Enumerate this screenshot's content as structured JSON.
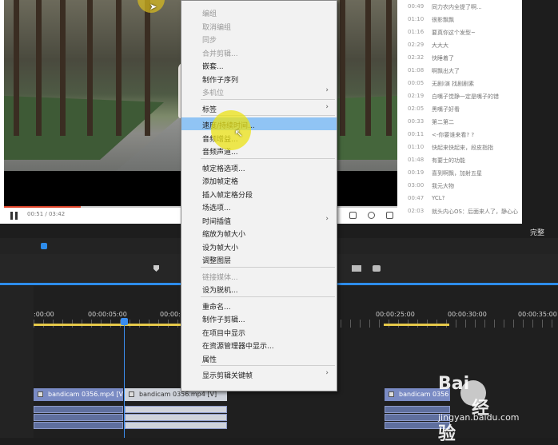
{
  "player": {
    "time": "00:51 / 03:42",
    "progress": 0.23
  },
  "comments": [
    {
      "t": "00:49",
      "m": "同力农内全提了啊..."
    },
    {
      "t": "01:10",
      "m": "很影飘飘"
    },
    {
      "t": "01:16",
      "m": "要真你这个发型~"
    },
    {
      "t": "02:29",
      "m": "大大大"
    },
    {
      "t": "02:32",
      "m": "快睡着了"
    },
    {
      "t": "01:08",
      "m": "啊飘出大了"
    },
    {
      "t": "00:05",
      "m": "无剧i演  找剧剧素"
    },
    {
      "t": "02:19",
      "m": "白嘴子觉静一定是嘴子的错"
    },
    {
      "t": "02:05",
      "m": "黑嘴子好看"
    },
    {
      "t": "00:33",
      "m": "第二第二"
    },
    {
      "t": "00:11",
      "m": "<-你要谁来看? ?"
    },
    {
      "t": "01:10",
      "m": "快起来快起来，段皮指指"
    },
    {
      "t": "01:48",
      "m": "有要士的功能"
    },
    {
      "t": "00:19",
      "m": "喜到啊飘，加射五星"
    },
    {
      "t": "03:00",
      "m": "我元大物"
    },
    {
      "t": "00:47",
      "m": "YCL?"
    },
    {
      "t": "02:03",
      "m": "就头内心OS：后面来人了，静心心"
    }
  ],
  "finish_label": "完整",
  "timeline": {
    "timecodes": [
      ":00:00",
      "00:00:05:00",
      "00:00:10:00",
      "00:00:25:00",
      "00:00:30:00",
      "00:00:35:00"
    ],
    "clips": [
      {
        "label": "bandicam 0356.mp4 [V]"
      },
      {
        "label": "bandicam 0356.mp4 [V]"
      },
      {
        "label": "bandicam 0356"
      }
    ]
  },
  "menu": {
    "items": [
      {
        "label": "编组",
        "disabled": true
      },
      {
        "label": "取消编组",
        "disabled": true
      },
      {
        "label": "同步",
        "disabled": true
      },
      {
        "label": "合并剪辑...",
        "disabled": true
      },
      {
        "label": "嵌套...",
        "disabled": false
      },
      {
        "label": "制作子序列",
        "disabled": false
      },
      {
        "label": "多机位",
        "disabled": true,
        "submenu": true
      },
      {
        "label": "标签",
        "disabled": false,
        "submenu": true
      },
      {
        "label": "速度/持续时间...",
        "disabled": false,
        "highlighted": true
      },
      {
        "label": "音频增益...",
        "disabled": false
      },
      {
        "label": "音频声道...",
        "disabled": false
      },
      {
        "label": "帧定格选项...",
        "disabled": false
      },
      {
        "label": "添加帧定格",
        "disabled": false
      },
      {
        "label": "插入帧定格分段",
        "disabled": false
      },
      {
        "label": "场选项...",
        "disabled": false
      },
      {
        "label": "时间插值",
        "disabled": false,
        "submenu": true
      },
      {
        "label": "缩放为帧大小",
        "disabled": false
      },
      {
        "label": "设为帧大小",
        "disabled": false
      },
      {
        "label": "调整图层",
        "disabled": false
      },
      {
        "label": "链接媒体...",
        "disabled": true
      },
      {
        "label": "设为脱机...",
        "disabled": false
      },
      {
        "label": "重命名...",
        "disabled": false
      },
      {
        "label": "制作子剪辑...",
        "disabled": false
      },
      {
        "label": "在项目中显示",
        "disabled": false
      },
      {
        "label": "在资源管理器中显示...",
        "disabled": false
      },
      {
        "label": "属性",
        "disabled": false
      },
      {
        "label": "显示剪辑关键帧",
        "disabled": false,
        "submenu": true
      }
    ],
    "submenu_arrow": "›"
  },
  "watermark": {
    "logo": "Bai",
    "logo2": "经验",
    "url": "jingyan.baidu.com"
  },
  "colors": {
    "highlight": "#90c4f4",
    "playhead": "#3b8ef0",
    "clip": "#7a8bc4"
  }
}
